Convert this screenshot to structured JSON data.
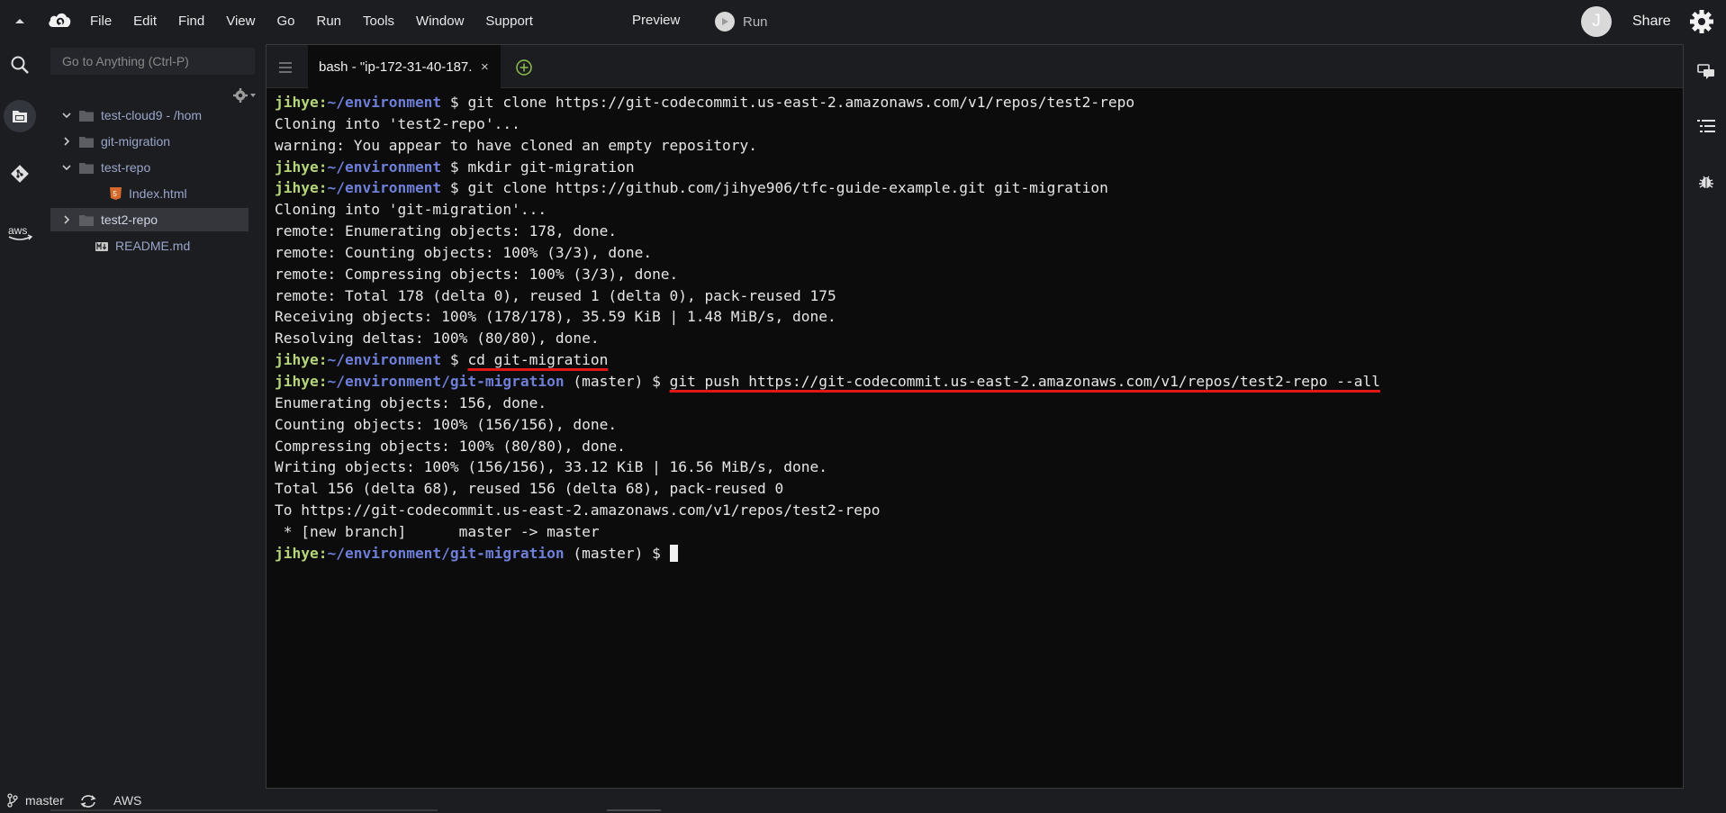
{
  "menubar": {
    "items": [
      "File",
      "Edit",
      "Find",
      "View",
      "Go",
      "Run",
      "Tools",
      "Window",
      "Support"
    ],
    "preview_label": "Preview",
    "run_label": "Run",
    "avatar_initial": "J",
    "share_label": "Share"
  },
  "sidebar": {
    "goto_placeholder": "Go to Anything (Ctrl-P)",
    "tree": [
      {
        "label": "test-cloud9 - /hom",
        "type": "folder",
        "expanded": true
      },
      {
        "label": "git-migration",
        "type": "folder",
        "expanded": false
      },
      {
        "label": "test-repo",
        "type": "folder",
        "expanded": true
      },
      {
        "label": "Index.html",
        "type": "html-file"
      },
      {
        "label": "test2-repo",
        "type": "folder",
        "expanded": false,
        "selected": true
      },
      {
        "label": "README.md",
        "type": "md-file"
      }
    ]
  },
  "editor": {
    "tab_title": "bash - \"ip-172-31-40-187.",
    "tab_close": "×"
  },
  "terminal": {
    "lines": [
      {
        "user": "jihye",
        "path": "~/environment",
        "branch": "",
        "cmd": "git clone https://git-codecommit.us-east-2.amazonaws.com/v1/repos/test2-repo"
      },
      {
        "text": "Cloning into 'test2-repo'..."
      },
      {
        "text": "warning: You appear to have cloned an empty repository."
      },
      {
        "user": "jihye",
        "path": "~/environment",
        "branch": "",
        "cmd": "mkdir git-migration"
      },
      {
        "user": "jihye",
        "path": "~/environment",
        "branch": "",
        "cmd": "git clone https://github.com/jihye906/tfc-guide-example.git git-migration"
      },
      {
        "text": "Cloning into 'git-migration'..."
      },
      {
        "text": "remote: Enumerating objects: 178, done."
      },
      {
        "text": "remote: Counting objects: 100% (3/3), done."
      },
      {
        "text": "remote: Compressing objects: 100% (3/3), done."
      },
      {
        "text": "remote: Total 178 (delta 0), reused 1 (delta 0), pack-reused 175"
      },
      {
        "text": "Receiving objects: 100% (178/178), 35.59 KiB | 1.48 MiB/s, done."
      },
      {
        "text": "Resolving deltas: 100% (80/80), done."
      },
      {
        "user": "jihye",
        "path": "~/environment",
        "branch": "",
        "cmd": "cd git-migration",
        "highlight": true
      },
      {
        "user": "jihye",
        "path": "~/environment/git-migration",
        "branch": " (master)",
        "cmd": "git push https://git-codecommit.us-east-2.amazonaws.com/v1/repos/test2-repo --all",
        "highlight": true
      },
      {
        "text": "Enumerating objects: 156, done."
      },
      {
        "text": "Counting objects: 100% (156/156), done."
      },
      {
        "text": "Compressing objects: 100% (80/80), done."
      },
      {
        "text": "Writing objects: 100% (156/156), 33.12 KiB | 16.56 MiB/s, done."
      },
      {
        "text": "Total 156 (delta 68), reused 156 (delta 68), pack-reused 0"
      },
      {
        "text": "To https://git-codecommit.us-east-2.amazonaws.com/v1/repos/test2-repo"
      },
      {
        "text": " * [new branch]      master -> master"
      },
      {
        "user": "jihye",
        "path": "~/environment/git-migration",
        "branch": " (master)",
        "cmd": "",
        "cursor": true
      }
    ]
  },
  "statusbar": {
    "branch": "master",
    "aws_label": "AWS"
  },
  "colors": {
    "background": "#1c1d21",
    "terminal_bg": "#0c0c0c",
    "prompt_user": "#b5d57a",
    "prompt_path": "#6e7fd8",
    "highlight_underline": "#e11717"
  }
}
